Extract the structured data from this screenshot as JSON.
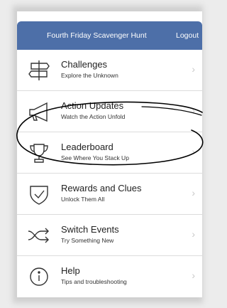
{
  "header": {
    "title": "Fourth Friday Scavenger Hunt",
    "logout_label": "Logout"
  },
  "menu": {
    "items": [
      {
        "label": "Challenges",
        "subtitle": "Explore the Unknown",
        "icon": "signpost-icon"
      },
      {
        "label": "Action Updates",
        "subtitle": "Watch the Action Unfold",
        "icon": "megaphone-icon"
      },
      {
        "label": "Leaderboard",
        "subtitle": "See Where You Stack Up",
        "icon": "trophy-icon"
      },
      {
        "label": "Rewards and Clues",
        "subtitle": "Unlock Them All",
        "icon": "shield-check-icon"
      },
      {
        "label": "Switch Events",
        "subtitle": "Try Something New",
        "icon": "shuffle-icon"
      },
      {
        "label": "Help",
        "subtitle": "Tips and troubleshooting",
        "icon": "info-icon"
      }
    ],
    "chevron": "›"
  },
  "colors": {
    "navbar": "#4d6fa8",
    "text": "#222222",
    "chevron": "#c8c8c8",
    "ink": "#000000"
  }
}
